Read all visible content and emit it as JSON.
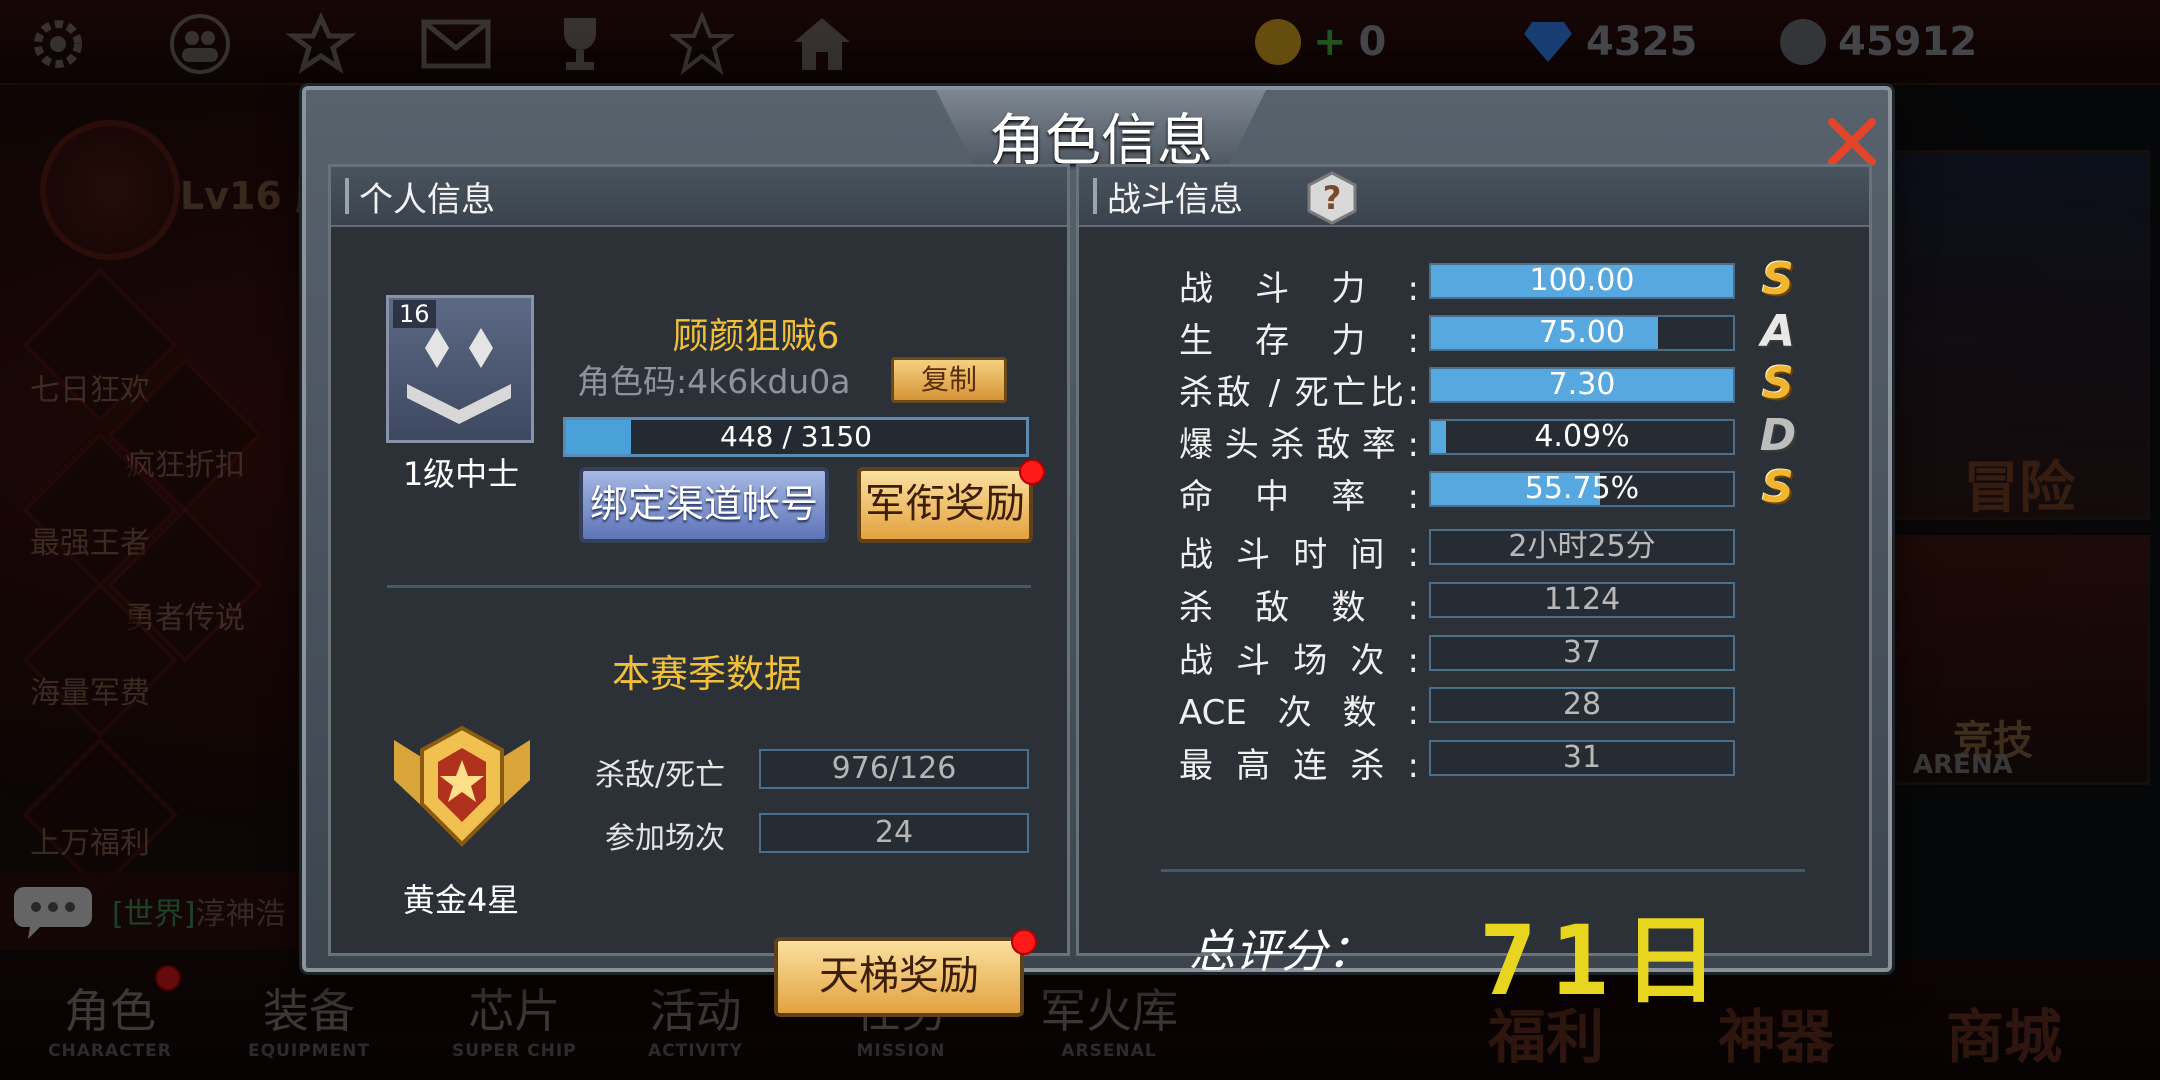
{
  "currencies": [
    {
      "icon": "gold-coin-icon",
      "value": "0"
    },
    {
      "icon": "diamond-icon",
      "value": "4325"
    },
    {
      "icon": "gp-coin-icon",
      "value": "45912"
    }
  ],
  "top_icons": [
    "gear-icon",
    "friends-icon",
    "rank-icon",
    "mail-icon",
    "trophy-icon",
    "star-emblem-icon",
    "home-icon"
  ],
  "player_level_badge": "Lv16",
  "player_level_name_fragment": "顾",
  "side_menu": [
    "七日狂欢",
    "疯狂折扣",
    "最强王者",
    "勇者传说",
    "海量军费",
    "上万福利"
  ],
  "chat": {
    "channel": "[世界]",
    "text": "淳神浩"
  },
  "bottom_nav": [
    {
      "cn": "角色",
      "en": "CHARACTER"
    },
    {
      "cn": "装备",
      "en": "EQUIPMENT"
    },
    {
      "cn": "芯片",
      "en": "SUPER CHIP"
    },
    {
      "cn": "活动",
      "en": "ACTIVITY"
    },
    {
      "cn": "任务",
      "en": "MISSION"
    },
    {
      "cn": "军火库",
      "en": "ARSENAL"
    }
  ],
  "big_nav": [
    "福利",
    "神器",
    "商城"
  ],
  "right_cards": [
    "冒险",
    "竞技",
    "ARENA"
  ],
  "dialog": {
    "title": "角色信息",
    "left": {
      "header": "个人信息",
      "rank_level": "16",
      "rank_name": "1级中士",
      "player_name": "顾颜狙贼6",
      "role_code": "角色码:4k6kdu0a",
      "copy_button": "复制",
      "xp_text": "448 / 3150",
      "xp_fraction": 0.142,
      "bind_button": "绑定渠道帐号",
      "rank_reward_button": "军衔奖励",
      "season_title": "本赛季数据",
      "season_rank": "黄金4星",
      "kd_label": "杀敌/死亡",
      "kd_value": "976/126",
      "matches_label": "参加场次",
      "matches_value": "24",
      "ladder_button": "天梯奖励"
    },
    "right": {
      "header": "战斗信息",
      "stats": [
        {
          "label": "战斗力:",
          "value": "100.00",
          "fill": 1.0,
          "grade": "S"
        },
        {
          "label": "生存力:",
          "value": "75.00",
          "fill": 0.75,
          "grade": "A"
        },
        {
          "label": "杀敌 / 死亡比:",
          "value": "7.30",
          "fill": 1.0,
          "grade": "S"
        },
        {
          "label": "爆头杀敌率:",
          "value": "4.09%",
          "fill": 0.05,
          "grade": "D"
        },
        {
          "label": "命中率:",
          "value": "55.75%",
          "fill": 0.56,
          "grade": "S"
        }
      ],
      "plain_stats": [
        {
          "label": "战斗时间:",
          "value": "2小时25分"
        },
        {
          "label": "杀敌数:",
          "value": "1124"
        },
        {
          "label": "战斗场次:",
          "value": "37"
        },
        {
          "label": "ACE次数:",
          "value": "28"
        },
        {
          "label": "最高连杀:",
          "value": "31"
        }
      ],
      "total_label": "总评分：",
      "total_score": "71日"
    }
  }
}
